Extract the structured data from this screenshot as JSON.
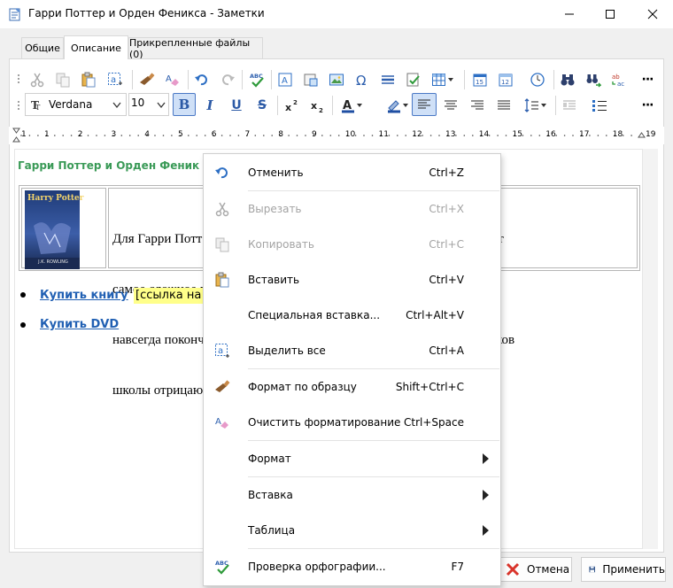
{
  "window": {
    "title": "Гарри Поттер и Орден Феникса - Заметки",
    "minimize": "—",
    "maximize": "☐",
    "close": "✕"
  },
  "tabs": [
    {
      "label": "Общие",
      "active": false
    },
    {
      "label": "Описание",
      "active": true
    },
    {
      "label": "Прикрепленные файлы (0)",
      "active": false
    }
  ],
  "toolbar": {
    "font_name": "Verdana",
    "font_size": "10",
    "bold": "B",
    "italic": "I",
    "underline": "U",
    "strike": "S",
    "more": "···"
  },
  "ruler": {
    "start": "1",
    "end": "19",
    "numbers": [
      "1",
      "2",
      "3",
      "4",
      "5",
      "6",
      "7",
      "8",
      "9",
      "10",
      "11",
      "12",
      "13",
      "14",
      "15",
      "16",
      "17",
      "18"
    ]
  },
  "document": {
    "title": "Гарри Поттер и Орден Феник",
    "description_lines": [
      "Для Гарри Потт                                                             вартсе, наступает",
      "самое сложное в                                                             йти способ как",
      "навсегда поконч                                                            чителей и учеников",
      "школы отрицаю"
    ],
    "cover_title": "Harry Potter",
    "cover_author": "J.K. ROWLING",
    "links": [
      {
        "label": "Купить книгу",
        "note": "[ссылка на"
      },
      {
        "label": "Купить DVD",
        "note": ""
      }
    ]
  },
  "context_menu": {
    "items": [
      {
        "label": "Отменить",
        "shortcut": "Ctrl+Z",
        "enabled": true,
        "icon": "undo-icon"
      },
      {
        "label": "Вырезать",
        "shortcut": "Ctrl+X",
        "enabled": false,
        "icon": "cut-icon"
      },
      {
        "label": "Копировать",
        "shortcut": "Ctrl+C",
        "enabled": false,
        "icon": "copy-icon"
      },
      {
        "label": "Вставить",
        "shortcut": "Ctrl+V",
        "enabled": true,
        "icon": "paste-icon"
      },
      {
        "label": "Специальная вставка...",
        "shortcut": "Ctrl+Alt+V",
        "enabled": true,
        "icon": ""
      },
      {
        "label": "Выделить все",
        "shortcut": "Ctrl+A",
        "enabled": true,
        "icon": "select-all-icon"
      },
      {
        "label": "Формат по образцу",
        "shortcut": "Shift+Ctrl+C",
        "enabled": true,
        "icon": "format-painter-icon"
      },
      {
        "label": "Очистить форматирование",
        "shortcut": "Ctrl+Space",
        "enabled": true,
        "icon": "clear-format-icon"
      },
      {
        "label": "Формат",
        "shortcut": "",
        "enabled": true,
        "icon": "",
        "submenu": true
      },
      {
        "label": "Вставка",
        "shortcut": "",
        "enabled": true,
        "icon": "",
        "submenu": true
      },
      {
        "label": "Таблица",
        "shortcut": "",
        "enabled": true,
        "icon": "",
        "submenu": true
      },
      {
        "label": "Проверка орфографии...",
        "shortcut": "F7",
        "enabled": true,
        "icon": "spellcheck-icon"
      }
    ]
  },
  "buttons": {
    "cancel": "Отмена",
    "apply": "Применить"
  },
  "colors": {
    "accent": "#4a78c5",
    "title_green": "#3a9a57",
    "link_blue": "#2160b3",
    "highlight": "#ffff8a"
  }
}
